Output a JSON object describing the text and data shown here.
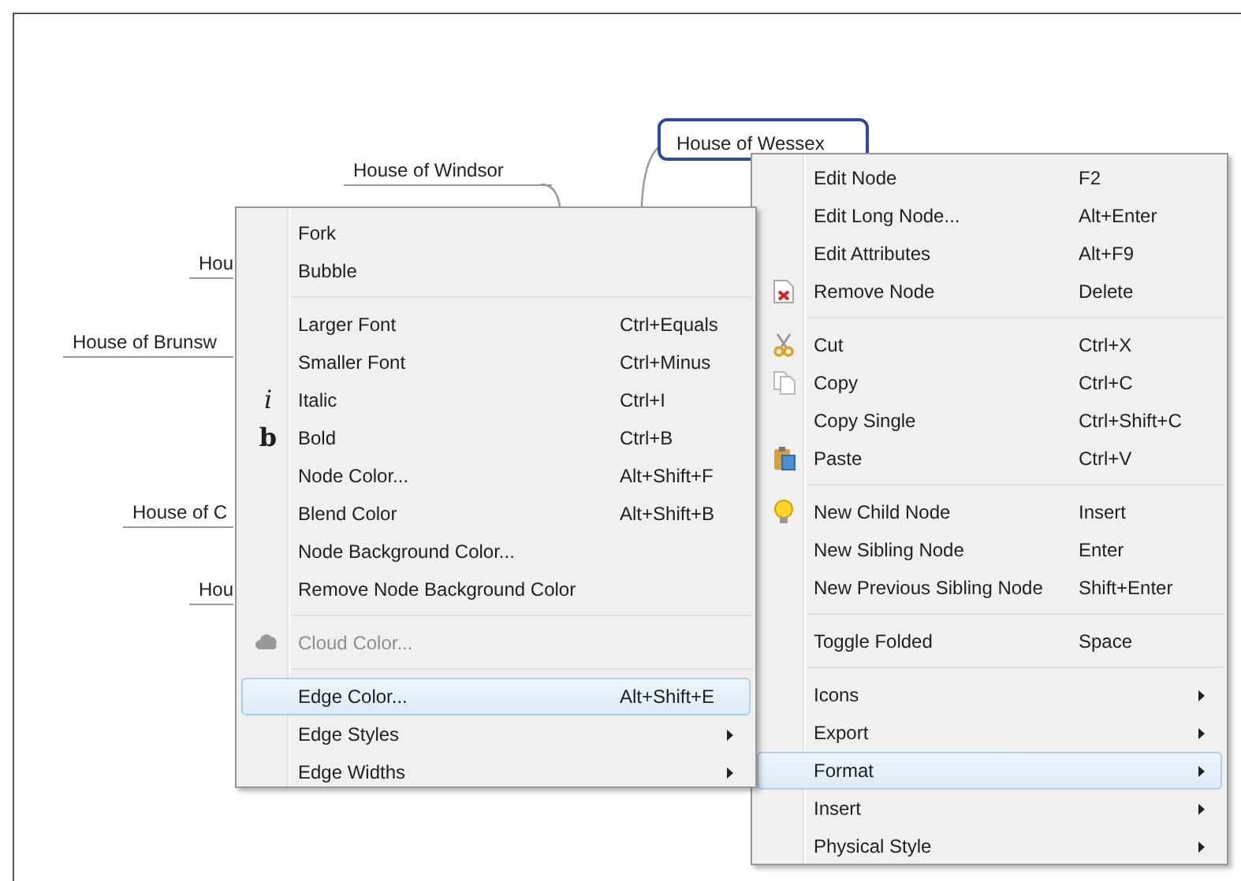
{
  "mind_map": {
    "root": {
      "label": "House of Wessex",
      "selected": true
    },
    "nodes": [
      {
        "label": "House of Windsor"
      },
      {
        "label": "Hou"
      },
      {
        "label": "House of Brunsw"
      },
      {
        "label": "House of C"
      },
      {
        "label": "Hou"
      }
    ]
  },
  "context_menu": {
    "items": [
      {
        "kind": "item",
        "label": "Edit Node",
        "shortcut": "F2",
        "selected": false,
        "disabled": false
      },
      {
        "kind": "item",
        "label": "Edit Long Node...",
        "shortcut": "Alt+Enter",
        "selected": false,
        "disabled": false
      },
      {
        "kind": "item",
        "label": "Edit Attributes",
        "shortcut": "Alt+F9",
        "selected": false,
        "disabled": false
      },
      {
        "kind": "item",
        "label": "Remove Node",
        "shortcut": "Delete",
        "selected": false,
        "disabled": false
      },
      {
        "kind": "separator"
      },
      {
        "kind": "item",
        "label": "Cut",
        "shortcut": "Ctrl+X",
        "selected": false,
        "disabled": false
      },
      {
        "kind": "item",
        "label": "Copy",
        "shortcut": "Ctrl+C",
        "selected": false,
        "disabled": false
      },
      {
        "kind": "item",
        "label": "Copy Single",
        "shortcut": "Ctrl+Shift+C",
        "selected": false,
        "disabled": false
      },
      {
        "kind": "item",
        "label": "Paste",
        "shortcut": "Ctrl+V",
        "selected": false,
        "disabled": false
      },
      {
        "kind": "separator"
      },
      {
        "kind": "item",
        "label": "New Child Node",
        "shortcut": "Insert",
        "selected": false,
        "disabled": false
      },
      {
        "kind": "item",
        "label": "New Sibling Node",
        "shortcut": "Enter",
        "selected": false,
        "disabled": false
      },
      {
        "kind": "item",
        "label": "New Previous Sibling Node",
        "shortcut": "Shift+Enter",
        "selected": false,
        "disabled": false
      },
      {
        "kind": "separator"
      },
      {
        "kind": "item",
        "label": "Toggle Folded",
        "shortcut": "Space",
        "selected": false,
        "disabled": false
      },
      {
        "kind": "separator"
      },
      {
        "kind": "submenu",
        "label": "Icons",
        "selected": false,
        "disabled": false
      },
      {
        "kind": "submenu",
        "label": "Export",
        "selected": false,
        "disabled": false
      },
      {
        "kind": "submenu",
        "label": "Format",
        "selected": true,
        "disabled": false
      },
      {
        "kind": "submenu",
        "label": "Insert",
        "selected": false,
        "disabled": false
      },
      {
        "kind": "submenu",
        "label": "Physical Style",
        "selected": false,
        "disabled": false
      }
    ]
  },
  "format_submenu": {
    "items": [
      {
        "kind": "item",
        "label": "Fork",
        "selected": false,
        "disabled": false
      },
      {
        "kind": "item",
        "label": "Bubble",
        "selected": false,
        "disabled": false
      },
      {
        "kind": "separator"
      },
      {
        "kind": "item",
        "label": "Larger Font",
        "shortcut": "Ctrl+Equals",
        "selected": false,
        "disabled": false
      },
      {
        "kind": "item",
        "label": "Smaller Font",
        "shortcut": "Ctrl+Minus",
        "selected": false,
        "disabled": false
      },
      {
        "kind": "item",
        "label": "Italic",
        "shortcut": "Ctrl+I",
        "glyph": "i",
        "selected": false,
        "disabled": false
      },
      {
        "kind": "item",
        "label": "Bold",
        "shortcut": "Ctrl+B",
        "glyph": "b",
        "selected": false,
        "disabled": false
      },
      {
        "kind": "item",
        "label": "Node Color...",
        "shortcut": "Alt+Shift+F",
        "selected": false,
        "disabled": false
      },
      {
        "kind": "item",
        "label": "Blend Color",
        "shortcut": "Alt+Shift+B",
        "selected": false,
        "disabled": false
      },
      {
        "kind": "item",
        "label": "Node Background Color...",
        "selected": false,
        "disabled": false
      },
      {
        "kind": "item",
        "label": "Remove Node Background Color",
        "selected": false,
        "disabled": false
      },
      {
        "kind": "separator"
      },
      {
        "kind": "item",
        "label": "Cloud Color...",
        "selected": false,
        "disabled": true
      },
      {
        "kind": "separator"
      },
      {
        "kind": "item",
        "label": "Edge Color...",
        "shortcut": "Alt+Shift+E",
        "selected": true,
        "disabled": false
      },
      {
        "kind": "submenu",
        "label": "Edge Styles",
        "selected": false,
        "disabled": false
      },
      {
        "kind": "submenu",
        "label": "Edge Widths",
        "selected": false,
        "disabled": false
      }
    ]
  }
}
